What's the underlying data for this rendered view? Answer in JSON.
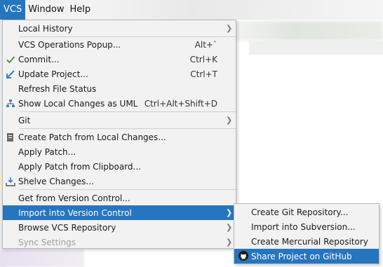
{
  "menubar": {
    "items": [
      {
        "label": "VCS",
        "active": true
      },
      {
        "label": "Window",
        "active": false
      },
      {
        "label": "Help",
        "active": false
      }
    ]
  },
  "vcs_menu": {
    "items": [
      {
        "label": "Local History",
        "shortcut": "",
        "submenu": true
      },
      {
        "label": "VCS Operations Popup...",
        "shortcut": "Alt+`",
        "submenu": false
      },
      {
        "label": "Commit...",
        "shortcut": "Ctrl+K",
        "submenu": false,
        "icon": "checkmark-icon"
      },
      {
        "label": "Update Project...",
        "shortcut": "Ctrl+T",
        "submenu": false,
        "icon": "update-arrow-icon"
      },
      {
        "label": "Refresh File Status",
        "shortcut": "",
        "submenu": false
      },
      {
        "label": "Show Local Changes as UML",
        "shortcut": "Ctrl+Alt+Shift+D",
        "submenu": false,
        "icon": "uml-diagram-icon"
      },
      {
        "label": "Git",
        "shortcut": "",
        "submenu": true
      },
      {
        "label": "Create Patch from Local Changes...",
        "shortcut": "",
        "submenu": false,
        "icon": "patch-file-icon"
      },
      {
        "label": "Apply Patch...",
        "shortcut": "",
        "submenu": false
      },
      {
        "label": "Apply Patch from Clipboard...",
        "shortcut": "",
        "submenu": false
      },
      {
        "label": "Shelve Changes...",
        "shortcut": "",
        "submenu": false,
        "icon": "shelve-icon"
      },
      {
        "label": "Get from Version Control...",
        "shortcut": "",
        "submenu": false
      },
      {
        "label": "Import into Version Control",
        "shortcut": "",
        "submenu": true,
        "highlighted": true
      },
      {
        "label": "Browse VCS Repository",
        "shortcut": "",
        "submenu": true
      },
      {
        "label": "Sync Settings",
        "shortcut": "",
        "submenu": true,
        "disabled": true
      }
    ]
  },
  "import_submenu": {
    "items": [
      {
        "label": "Create Git Repository..."
      },
      {
        "label": "Import into Subversion..."
      },
      {
        "label": "Create Mercurial Repository"
      },
      {
        "label": "Share Project on GitHub",
        "highlighted": true,
        "icon": "github-icon"
      }
    ]
  },
  "colors": {
    "highlight": "#2675bf",
    "menu_bg": "#f2f2f2",
    "checkmark": "#4a9a3a",
    "update_arrow": "#3a7fd0"
  }
}
